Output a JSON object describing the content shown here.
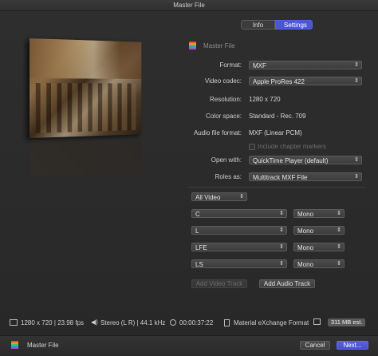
{
  "window": {
    "title": "Master File"
  },
  "tabs": [
    {
      "label": "Info"
    },
    {
      "label": "Settings"
    }
  ],
  "header": {
    "title": "Master File"
  },
  "form": {
    "format": {
      "label": "Format:",
      "value": "MXF"
    },
    "video_codec": {
      "label": "Video codec:",
      "value": "Apple ProRes 422"
    },
    "resolution": {
      "label": "Resolution:",
      "value": "1280 x 720"
    },
    "color_space": {
      "label": "Color space:",
      "value": "Standard - Rec. 709"
    },
    "audio_format": {
      "label": "Audio file format:",
      "value": "MXF (Linear PCM)"
    },
    "chapter_markers": {
      "label": "Include chapter markers"
    },
    "open_with": {
      "label": "Open with:",
      "value": "QuickTime Player (default)"
    },
    "roles_as": {
      "label": "Roles as:",
      "value": "Multitrack MXF File"
    }
  },
  "roles": {
    "video": {
      "value": "All Video"
    },
    "audio": [
      {
        "role": "C",
        "channel": "Mono"
      },
      {
        "role": "L",
        "channel": "Mono"
      },
      {
        "role": "LFE",
        "channel": "Mono"
      },
      {
        "role": "LS",
        "channel": "Mono"
      }
    ],
    "add_video_label": "Add Video Track",
    "add_audio_label": "Add Audio Track"
  },
  "status": {
    "resolution_fps": "1280 x 720 | 23.98 fps",
    "audio": "Stereo (L R) | 44.1 kHz",
    "duration": "00:00:37:22",
    "format": "Material eXchange Format",
    "size": "311 MB est."
  },
  "footer": {
    "title": "Master File",
    "cancel_label": "Cancel",
    "next_label": "Next..."
  },
  "icons": {
    "select_arrow": "⌃⌄",
    "speaker": "🔈"
  },
  "colors": {
    "accent": "#4b55d6"
  }
}
